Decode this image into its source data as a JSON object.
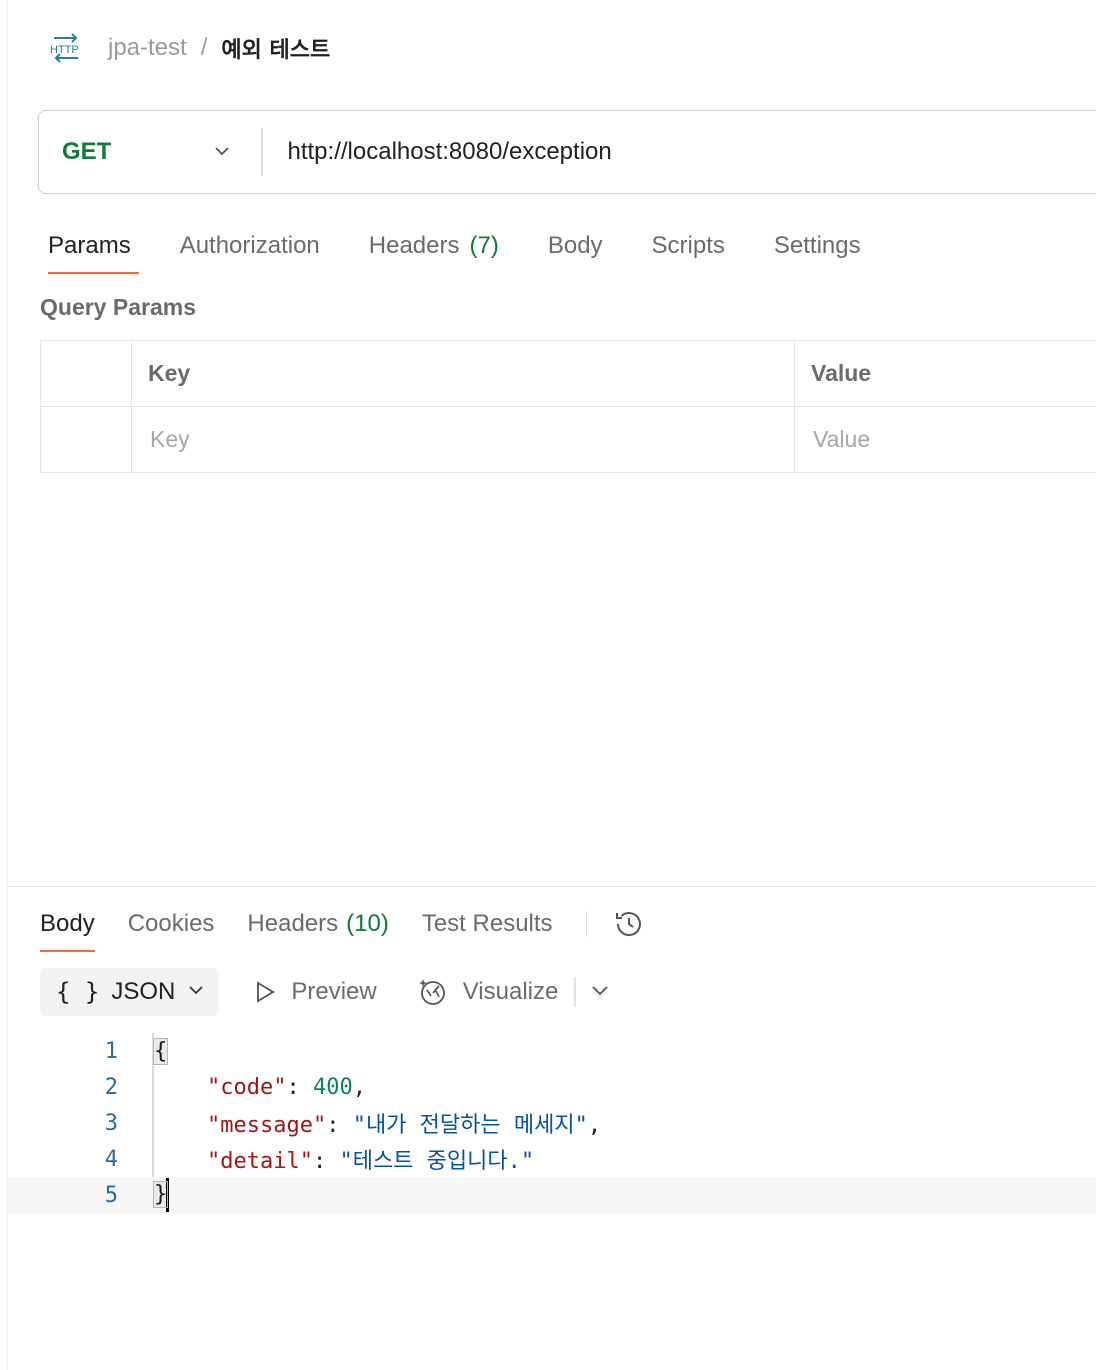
{
  "breadcrumb": {
    "icon": "http-icon",
    "icon_text": "HTTP",
    "parent": "jpa-test",
    "separator": "/",
    "current": "예외 테스트"
  },
  "request": {
    "method": "GET",
    "url": "http://localhost:8080/exception"
  },
  "request_tabs": [
    {
      "label": "Params",
      "active": true
    },
    {
      "label": "Authorization"
    },
    {
      "label": "Headers",
      "count": "(7)"
    },
    {
      "label": "Body"
    },
    {
      "label": "Scripts"
    },
    {
      "label": "Settings"
    }
  ],
  "query_params": {
    "title": "Query Params",
    "columns": [
      "Key",
      "Value"
    ],
    "placeholders": {
      "key": "Key",
      "value": "Value"
    }
  },
  "response_tabs": [
    {
      "label": "Body",
      "active": true
    },
    {
      "label": "Cookies"
    },
    {
      "label": "Headers",
      "count": "(10)"
    },
    {
      "label": "Test Results"
    }
  ],
  "format_bar": {
    "format_icon_text": "{ }",
    "format": "JSON",
    "preview": "Preview",
    "visualize": "Visualize"
  },
  "response_body": {
    "line_numbers": [
      "1",
      "2",
      "3",
      "4",
      "5"
    ],
    "lines": {
      "open": "{",
      "code_key": "\"code\"",
      "code_value": "400",
      "message_key": "\"message\"",
      "message_value": "\"내가 전달하는 메세지\"",
      "detail_key": "\"detail\"",
      "detail_value": "\"테스트 중입니다.\"",
      "close": "}"
    }
  },
  "colors": {
    "method_get": "#0f7b3b",
    "active_tab_underline": "#f06b39",
    "count": "#0f7b3b",
    "json_key": "#a31515",
    "json_number": "#098658",
    "json_string": "#0451a5",
    "line_number": "#2d6b9f"
  }
}
